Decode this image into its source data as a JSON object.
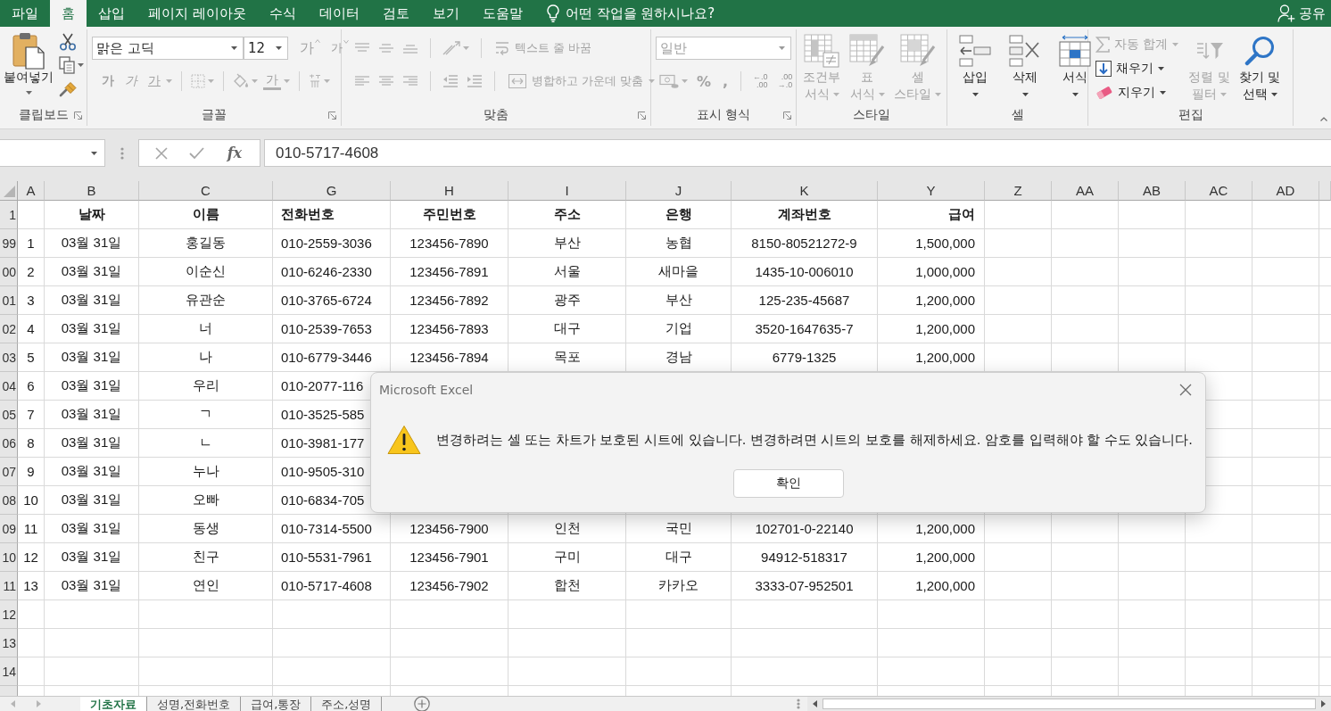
{
  "ribbon_tabs": [
    {
      "label": "파일",
      "selected": false
    },
    {
      "label": "홈",
      "selected": true
    },
    {
      "label": "삽입",
      "selected": false
    },
    {
      "label": "페이지 레이아웃",
      "selected": false
    },
    {
      "label": "수식",
      "selected": false
    },
    {
      "label": "데이터",
      "selected": false
    },
    {
      "label": "검토",
      "selected": false
    },
    {
      "label": "보기",
      "selected": false
    },
    {
      "label": "도움말",
      "selected": false
    }
  ],
  "tell_me": "어떤 작업을 원하시나요?",
  "share": "공유",
  "ribbon_groups": [
    {
      "kind": "clipboard",
      "title": "클립보드",
      "launcher": true,
      "paste": "붙여넣기"
    },
    {
      "kind": "font",
      "title": "글꼴",
      "launcher": true,
      "font_name": "맑은 고딕",
      "font_size": "12",
      "grow": "가",
      "shrink": "가",
      "bold": "가",
      "italic": "가",
      "underline": "가",
      "font_color": "가",
      "disabled": true
    },
    {
      "kind": "alignment",
      "title": "맞춤",
      "launcher": true,
      "wrap_text": "텍스트 줄 바꿈",
      "merge_center": "병합하고 가운데 맞춤",
      "disabled": true
    },
    {
      "kind": "number",
      "title": "표시 형식",
      "launcher": true,
      "format": "일반",
      "percent": "%",
      "comma": ",",
      "decimals": [
        {
          "top": "←.0",
          "bottom": ".00"
        },
        {
          "top": ".00",
          "bottom": "→.0"
        }
      ],
      "disabled": true
    },
    {
      "kind": "styles",
      "title": "스타일",
      "launcher": false,
      "commands": [
        {
          "kind": "conditional",
          "lines": [
            "조건부",
            "서식"
          ],
          "disabled": true
        },
        {
          "kind": "table",
          "lines": [
            "표",
            "서식"
          ],
          "disabled": true
        },
        {
          "kind": "cell_style",
          "lines": [
            "셀",
            "스타일"
          ],
          "disabled": true
        }
      ]
    },
    {
      "kind": "cells",
      "title": "셀",
      "launcher": false,
      "commands": [
        {
          "kind": "insert",
          "label": "삽입",
          "disabled": false
        },
        {
          "kind": "delete",
          "label": "삭제",
          "disabled": false
        },
        {
          "kind": "format",
          "label": "서식",
          "disabled": false
        }
      ]
    },
    {
      "kind": "editing",
      "title": "편집",
      "launcher": false,
      "small": [
        {
          "kind": "autosum",
          "label": "자동 합계",
          "disabled": true
        },
        {
          "kind": "fill",
          "label": "채우기",
          "disabled": false
        },
        {
          "kind": "clear",
          "label": "지우기",
          "disabled": false
        }
      ],
      "large": [
        {
          "kind": "sort",
          "lines": [
            "정렬 및",
            "필터"
          ],
          "disabled": true
        },
        {
          "kind": "find",
          "lines": [
            "찾기 및",
            "선택"
          ],
          "disabled": false
        }
      ]
    }
  ],
  "formula_bar": {
    "fx": "fx",
    "formula": "010-5717-4608"
  },
  "sheet": {
    "columns": [
      "A",
      "B",
      "C",
      "G",
      "H",
      "I",
      "J",
      "K",
      "Y",
      "Z",
      "AA",
      "AB",
      "AC",
      "AD"
    ],
    "rows": [
      {
        "header": "1",
        "kind": "heading",
        "cells": [
          null,
          "날짜",
          "이름",
          "전화번호",
          "주민번호",
          "주소",
          "은행",
          "계좌번호",
          "급여"
        ]
      },
      {
        "header": "99",
        "kind": "data",
        "cells": [
          "1",
          "03월 31일",
          "홍길동",
          "010-2559-3036",
          "123456-7890",
          "부산",
          "농협",
          "8150-80521272-9",
          "1,500,000"
        ]
      },
      {
        "header": "00",
        "kind": "data",
        "cells": [
          "2",
          "03월 31일",
          "이순신",
          "010-6246-2330",
          "123456-7891",
          "서울",
          "새마을",
          "1435-10-006010",
          "1,000,000"
        ]
      },
      {
        "header": "01",
        "kind": "data",
        "cells": [
          "3",
          "03월 31일",
          "유관순",
          "010-3765-6724",
          "123456-7892",
          "광주",
          "부산",
          "125-235-45687",
          "1,200,000"
        ]
      },
      {
        "header": "02",
        "kind": "data",
        "cells": [
          "4",
          "03월 31일",
          "너",
          "010-2539-7653",
          "123456-7893",
          "대구",
          "기업",
          "3520-1647635-7",
          "1,200,000"
        ]
      },
      {
        "header": "03",
        "kind": "data",
        "cells": [
          "5",
          "03월 31일",
          "나",
          "010-6779-3446",
          "123456-7894",
          "목포",
          "경남",
          "6779-1325",
          "1,200,000"
        ]
      },
      {
        "header": "04",
        "kind": "data",
        "cells": [
          "6",
          "03월 31일",
          "우리",
          "010-2077-116"
        ]
      },
      {
        "header": "05",
        "kind": "data",
        "cells": [
          "7",
          "03월 31일",
          "ㄱ",
          "010-3525-585"
        ]
      },
      {
        "header": "06",
        "kind": "data",
        "cells": [
          "8",
          "03월 31일",
          "ㄴ",
          "010-3981-177"
        ]
      },
      {
        "header": "07",
        "kind": "data",
        "cells": [
          "9",
          "03월 31일",
          "누나",
          "010-9505-310"
        ]
      },
      {
        "header": "08",
        "kind": "data",
        "cells": [
          "10",
          "03월 31일",
          "오빠",
          "010-6834-705"
        ]
      },
      {
        "header": "09",
        "kind": "data",
        "cells": [
          "11",
          "03월 31일",
          "동생",
          "010-7314-5500",
          "123456-7900",
          "인천",
          "국민",
          "102701-0-22140",
          "1,200,000"
        ]
      },
      {
        "header": "10",
        "kind": "data",
        "cells": [
          "12",
          "03월 31일",
          "친구",
          "010-5531-7961",
          "123456-7901",
          "구미",
          "대구",
          "94912-518317",
          "1,200,000"
        ]
      },
      {
        "header": "11",
        "kind": "data",
        "cells": [
          "13",
          "03월 31일",
          "연인",
          "010-5717-4608",
          "123456-7902",
          "합천",
          "카카오",
          "3333-07-952501",
          "1,200,000"
        ]
      },
      {
        "header": "12",
        "kind": "data"
      },
      {
        "header": "13",
        "kind": "data"
      },
      {
        "header": "14",
        "kind": "data"
      }
    ]
  },
  "sheet_tabs": [
    {
      "label": "기초자료",
      "selected": true
    },
    {
      "label": "성명,전화번호",
      "selected": false
    },
    {
      "label": "급여,통장",
      "selected": false
    },
    {
      "label": "주소,성명",
      "selected": false
    }
  ],
  "dialog": {
    "title": "Microsoft Excel",
    "message": "변경하려는 셀 또는 차트가 보호된 시트에 있습니다. 변경하려면 시트의 보호를 해제하세요. 암호를 입력해야 할 수도 있습니다.",
    "button": "확인"
  }
}
